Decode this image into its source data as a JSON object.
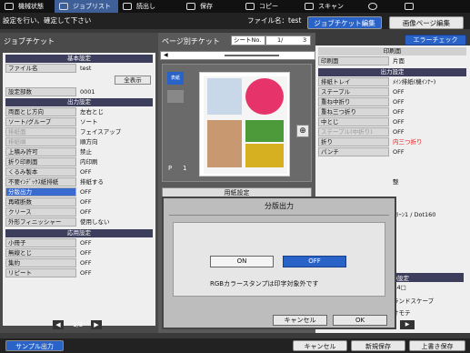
{
  "menu": {
    "tabs": [
      {
        "label": "機械状態",
        "icon": "machine-status-icon"
      },
      {
        "label": "ジョブリスト",
        "icon": "job-list-icon"
      },
      {
        "label": "読出し",
        "icon": "folder-icon"
      },
      {
        "label": "保存",
        "icon": "save-icon"
      },
      {
        "label": "コピー",
        "icon": "copy-icon"
      },
      {
        "label": "スキャン",
        "icon": "scan-icon"
      },
      {
        "label": "",
        "icon": "globe-icon"
      },
      {
        "label": "",
        "icon": "settings-icon"
      }
    ]
  },
  "info": {
    "message": "設定を行い、確定して下さい",
    "filename_label": "ファイル名：test",
    "tab_job_ticket_edit": "ジョブチケット編集",
    "tab_image_page_edit": "画像ページ編集"
  },
  "left": {
    "title": "ジョブチケット",
    "sections": {
      "basic": "基本設定",
      "output": "出力設定",
      "apply": "応用設定"
    },
    "basic_rows": [
      {
        "key": "ファイル名",
        "value": "test"
      },
      {
        "key": "設定部数",
        "value": "0001"
      }
    ],
    "show_all_button": "全表示",
    "output_rows": [
      {
        "key": "両面とじ方向",
        "value": "左右とじ"
      },
      {
        "key": "ソート/グループ",
        "value": "ソート"
      },
      {
        "key": "排紙面",
        "value": "フェイスアップ"
      },
      {
        "key": "排紙順",
        "value": "順方向"
      },
      {
        "key": "上積み許可",
        "value": "禁止"
      },
      {
        "key": "折り印刷面",
        "value": "内印刷"
      },
      {
        "key": "くるみ製本",
        "value": "OFF"
      },
      {
        "key": "不要ｲﾝﾃﾞｯｸｽ紙排紙",
        "value": "排紙する"
      },
      {
        "key": "分版出力",
        "value": "OFF"
      },
      {
        "key": "再確断数",
        "value": "OFF"
      },
      {
        "key": "クリース",
        "value": "OFF"
      },
      {
        "key": "外形フィニッシャー",
        "value": "使用しない"
      }
    ],
    "apply_rows": [
      {
        "key": "小冊子",
        "value": "OFF"
      },
      {
        "key": "無線とじ",
        "value": "OFF"
      },
      {
        "key": "集約",
        "value": "OFF"
      },
      {
        "key": "リピート",
        "value": "OFF"
      }
    ],
    "pager": "1/3"
  },
  "center": {
    "title": "ページ別チケット",
    "sheet_label": "シートNo.",
    "sheet_value": "1/",
    "sheet_total": "3",
    "page_label": "P",
    "page_number": "1",
    "paper_settings": "用紙設定"
  },
  "right": {
    "error_check_button": "エラーチェック",
    "print_section": "印刷面",
    "print_rows": [
      {
        "key": "印刷面",
        "value": "片面"
      }
    ],
    "output_section": "出力設定",
    "output_rows": [
      {
        "key": "排紙トレイ",
        "value": "ﾒｲﾝ排紙(機ｲﾝﾅｰ)"
      },
      {
        "key": "ステープル",
        "value": "OFF"
      },
      {
        "key": "重ね中折り",
        "value": "OFF"
      },
      {
        "key": "重ね三つ折り",
        "value": "OFF"
      },
      {
        "key": "中とじ",
        "value": "OFF"
      },
      {
        "key": "ステープル(中折り)",
        "value": "OFF"
      },
      {
        "key": "折り",
        "value": "内三つ折り"
      },
      {
        "key": "パンチ",
        "value": "OFF"
      }
    ],
    "partial": [
      {
        "text": "整"
      },
      {
        "text": "ｸﾘｰﾝ1 / Dot160"
      },
      {
        "text": "F"
      },
      {
        "text": "F"
      },
      {
        "text": "F"
      },
      {
        "text": "F"
      },
      {
        "text": "D設定"
      },
      {
        "text": "A4□"
      },
      {
        "text": "ランドスケープ"
      },
      {
        "text": "オモテ"
      }
    ]
  },
  "dialog": {
    "title": "分版出力",
    "on_label": "ON",
    "off_label": "OFF",
    "note": "RGBカラースタンプは印字対象外です",
    "cancel_label": "キャンセル",
    "ok_label": "OK"
  },
  "bottom": {
    "sample_output": "サンプル出力",
    "cancel": "キャンセル",
    "save_new": "新規保存",
    "overwrite_save": "上書き保存"
  },
  "colors": {
    "accent": "#3f5f99",
    "selected": "#3a6bd0",
    "red": "#e02020"
  }
}
